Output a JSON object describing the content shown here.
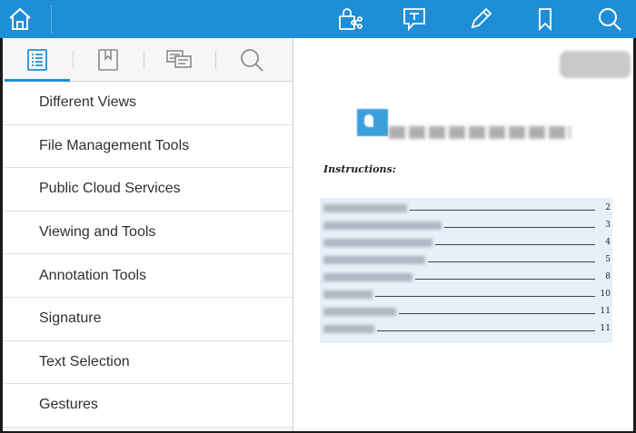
{
  "toolbar": {
    "icons": [
      "home-icon",
      "share-lock-icon",
      "typewriter-icon",
      "pen-icon",
      "bookmark-icon",
      "search-icon"
    ],
    "accent": "#1e8fd6"
  },
  "sidebar": {
    "tabs": [
      {
        "icon": "list-icon",
        "active": true
      },
      {
        "icon": "bookmark-icon",
        "active": false
      },
      {
        "icon": "comments-icon",
        "active": false
      },
      {
        "icon": "search-icon",
        "active": false
      }
    ],
    "items": [
      {
        "label": "Different Views"
      },
      {
        "label": "File Management Tools"
      },
      {
        "label": "Public Cloud Services"
      },
      {
        "label": "Viewing and Tools"
      },
      {
        "label": "Annotation Tools"
      },
      {
        "label": "Signature"
      },
      {
        "label": "Text Selection"
      },
      {
        "label": "Gestures"
      }
    ]
  },
  "document": {
    "instructions_label": "Instructions:",
    "toc_pages": [
      "2",
      "3",
      "4",
      "5",
      "8",
      "10",
      "11",
      "11"
    ]
  }
}
